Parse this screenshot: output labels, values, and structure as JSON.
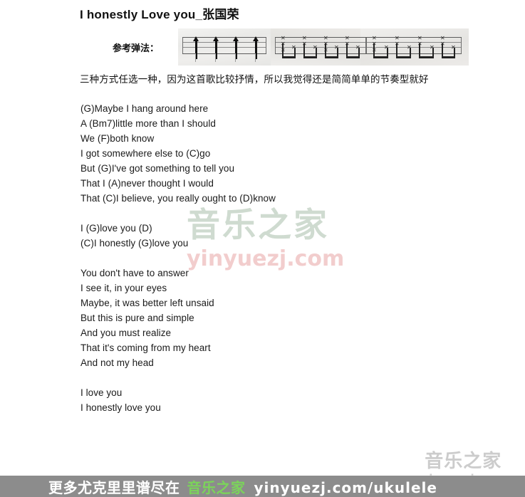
{
  "document": {
    "title": "I honestly Love you_张国荣"
  },
  "notation": {
    "label": "参考弹法：",
    "patterns": [
      {
        "name": "pattern-up-strums",
        "beats": 4,
        "style": "up-arrow"
      },
      {
        "name": "pattern-x-beams-1",
        "beats": 4,
        "style": "x-beamed"
      },
      {
        "name": "pattern-x-beams-2",
        "beats": 4,
        "style": "x-beamed"
      }
    ]
  },
  "intro": {
    "text": "三种方式任选一种，因为这首歌比较抒情，所以我觉得还是简简单单的节奏型就好"
  },
  "lyrics": {
    "stanzas": [
      {
        "name": "verse-1",
        "lines": [
          "(G)Maybe I hang around here",
          "A (Bm7)little more than I should",
          "We (F)both know",
          "I got somewhere else to (C)go",
          "But (G)I've got something to tell you",
          "That I (A)never thought I would",
          "That (C)I believe, you really ought to (D)know"
        ]
      },
      {
        "name": "chorus-1",
        "lines": [
          "I (G)love you (D)",
          "(C)I honestly (G)love you"
        ]
      },
      {
        "name": "verse-2",
        "lines": [
          "You don't have to answer",
          "I see it, in your eyes",
          "Maybe, it was better left unsaid",
          "But this is pure and simple",
          "And you must realize",
          "That it's coming from my heart",
          "And not my head"
        ]
      },
      {
        "name": "outro",
        "lines": [
          "I love you",
          "I honestly love you"
        ]
      }
    ]
  },
  "watermark_center": {
    "brand": "音乐之家",
    "url": "yinyuezj.com"
  },
  "watermark_corner": {
    "brand": "音乐之家",
    "url": "yinyuezj.com"
  },
  "footer": {
    "prefix": "更多尤克里里谱尽在",
    "brand": "音乐之家",
    "url": "yinyuezj.com/ukulele"
  },
  "colors": {
    "footer_background": "#8c8c8c",
    "footer_brand_green": "#7bd45a",
    "watermark_green": "#cfdbd0",
    "watermark_pink": "#f2cdcd"
  }
}
